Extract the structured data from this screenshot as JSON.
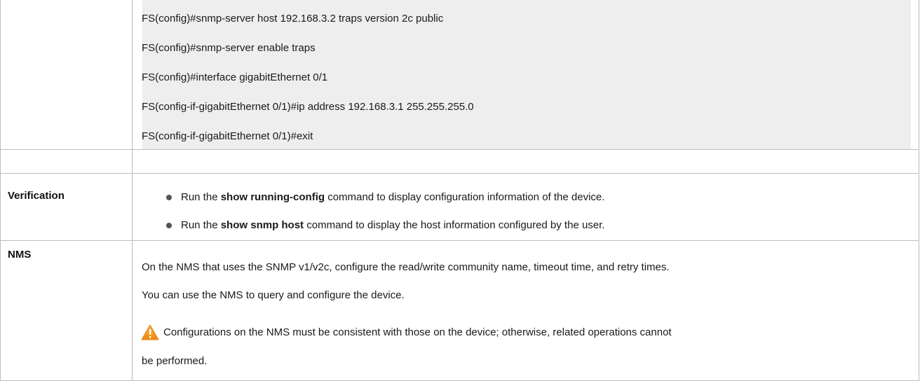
{
  "code_block": {
    "lines": [
      "FS(config)#snmp-server host 192.168.3.2 traps version 2c public",
      "FS(config)#snmp-server enable traps",
      "FS(config)#interface gigabitEthernet 0/1",
      "FS(config-if-gigabitEthernet 0/1)#ip address 192.168.3.1 255.255.255.0",
      "FS(config-if-gigabitEthernet 0/1)#exit"
    ]
  },
  "verification": {
    "label": "Verification",
    "items": [
      {
        "pre": "Run the ",
        "bold": "show running-config",
        "post": " command to display configuration information of the device."
      },
      {
        "pre": "Run the ",
        "bold": "show snmp host",
        "post": " command to display the host information configured by the user."
      }
    ]
  },
  "nms": {
    "label": "NMS",
    "para1": "On the NMS that uses the SNMP v1/v2c, configure the read/write community name, timeout time, and retry times.",
    "para2": "You can use the NMS to query and configure the device.",
    "warning_icon": "warning-triangle-icon",
    "warning_line1": "Configurations on the NMS must be consistent with those on the device; otherwise, related operations cannot",
    "warning_line2": "be performed."
  },
  "colors": {
    "code_background": "#eeeeee",
    "border": "#bdbdbd",
    "warning_orange": "#f39a1e"
  }
}
